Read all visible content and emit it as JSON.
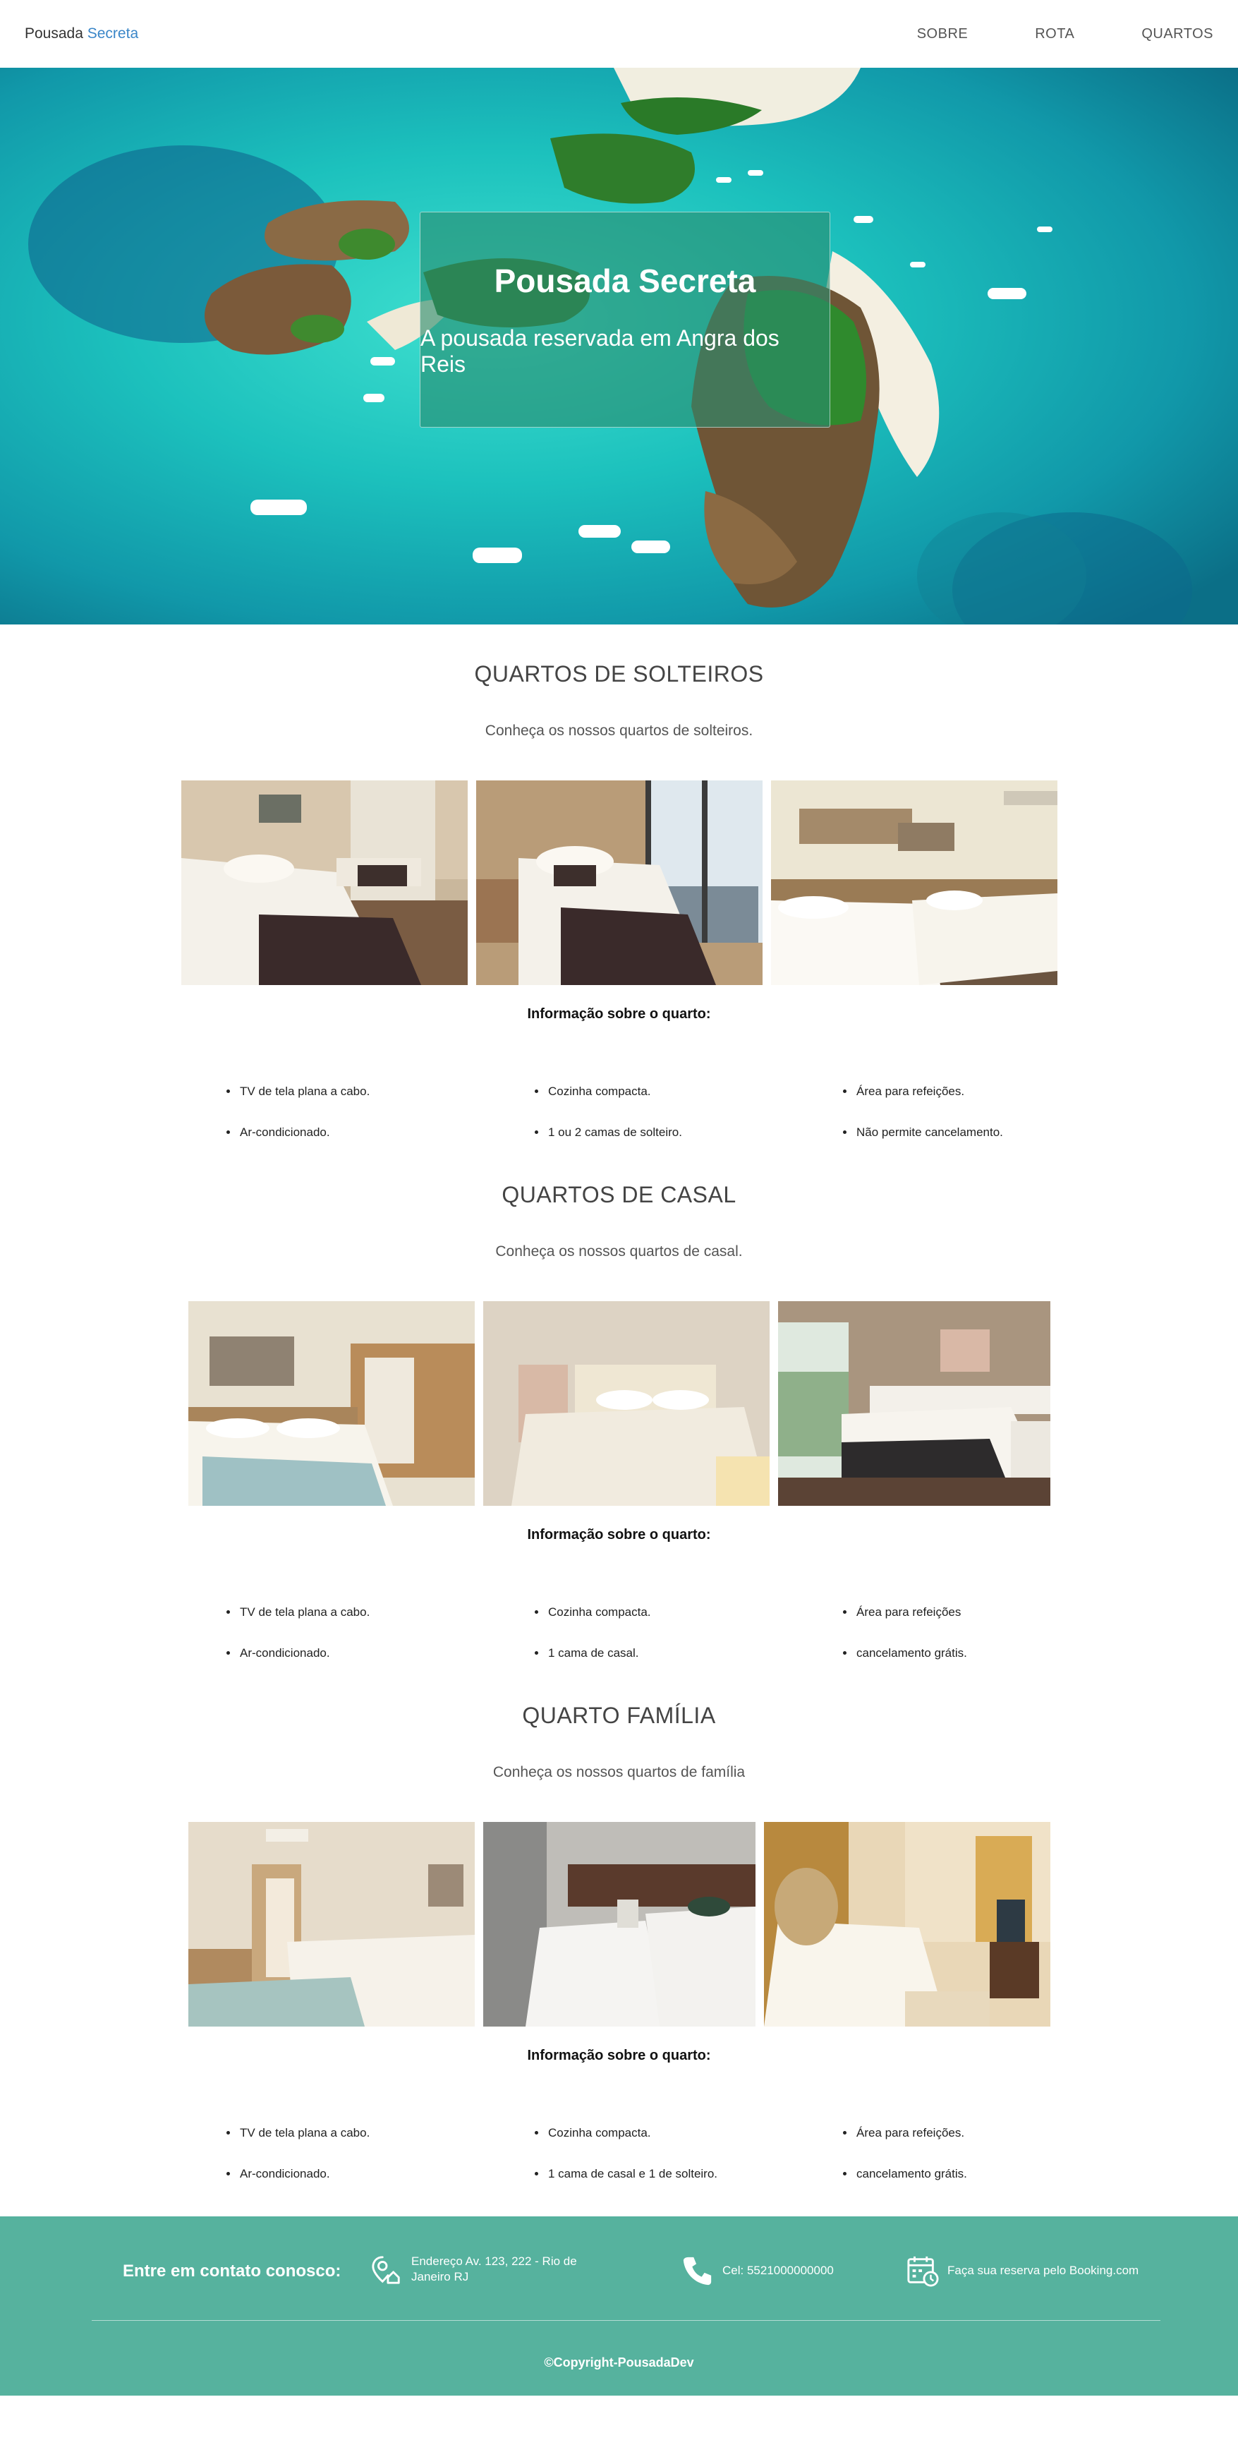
{
  "nav": {
    "brand_main": "Pousada",
    "brand_accent": "Secreta",
    "links": [
      "SOBRE",
      "ROTA",
      "QUARTOS"
    ]
  },
  "hero": {
    "title": "Pousada Secreta",
    "subtitle": "A pousada reservada em Angra dos Reis"
  },
  "sections": [
    {
      "title": "QUARTOS DE SOLTEIROS",
      "lead": "Conheça os nossos quartos de solteiros.",
      "info_title": "Informação sobre o quarto:",
      "col1": [
        "TV de tela plana a cabo.",
        "Ar-condicionado."
      ],
      "col2": [
        "Cozinha compacta.",
        "1 ou 2 camas de solteiro."
      ],
      "col3": [
        "Área para refeições.",
        "Não permite cancelamento."
      ]
    },
    {
      "title": "QUARTOS DE CASAL",
      "lead": "Conheça os nossos quartos de casal.",
      "info_title": "Informação sobre o quarto:",
      "col1": [
        "TV de tela plana a cabo.",
        "Ar-condicionado."
      ],
      "col2": [
        "Cozinha compacta.",
        "1 cama de casal."
      ],
      "col3": [
        "Área para refeições",
        "cancelamento grátis."
      ]
    },
    {
      "title": "QUARTO FAMÍLIA",
      "lead": "Conheça os nossos quartos de família",
      "info_title": "Informação sobre o quarto:",
      "col1": [
        "TV de tela plana a cabo.",
        "Ar-condicionado."
      ],
      "col2": [
        "Cozinha compacta.",
        "1 cama de casal e 1 de solteiro."
      ],
      "col3": [
        "Área para refeições.",
        "cancelamento grátis."
      ]
    }
  ],
  "footer": {
    "contact_title": "Entre em contato conosco:",
    "address_line1": "Endereço Av. 123, 222 - Rio de",
    "address_line2": "Janeiro RJ",
    "phone": "Cel: 5521000000000",
    "booking": "Faça sua reserva pelo Booking.com",
    "copyright": "©Copyright-PousadaDev",
    "icons": [
      "location-icon",
      "phone-icon",
      "calendar-icon"
    ]
  },
  "colors": {
    "accent": "#3a86c8",
    "footer_bg": "#56b29e",
    "hero_box": "#2a8c70"
  }
}
